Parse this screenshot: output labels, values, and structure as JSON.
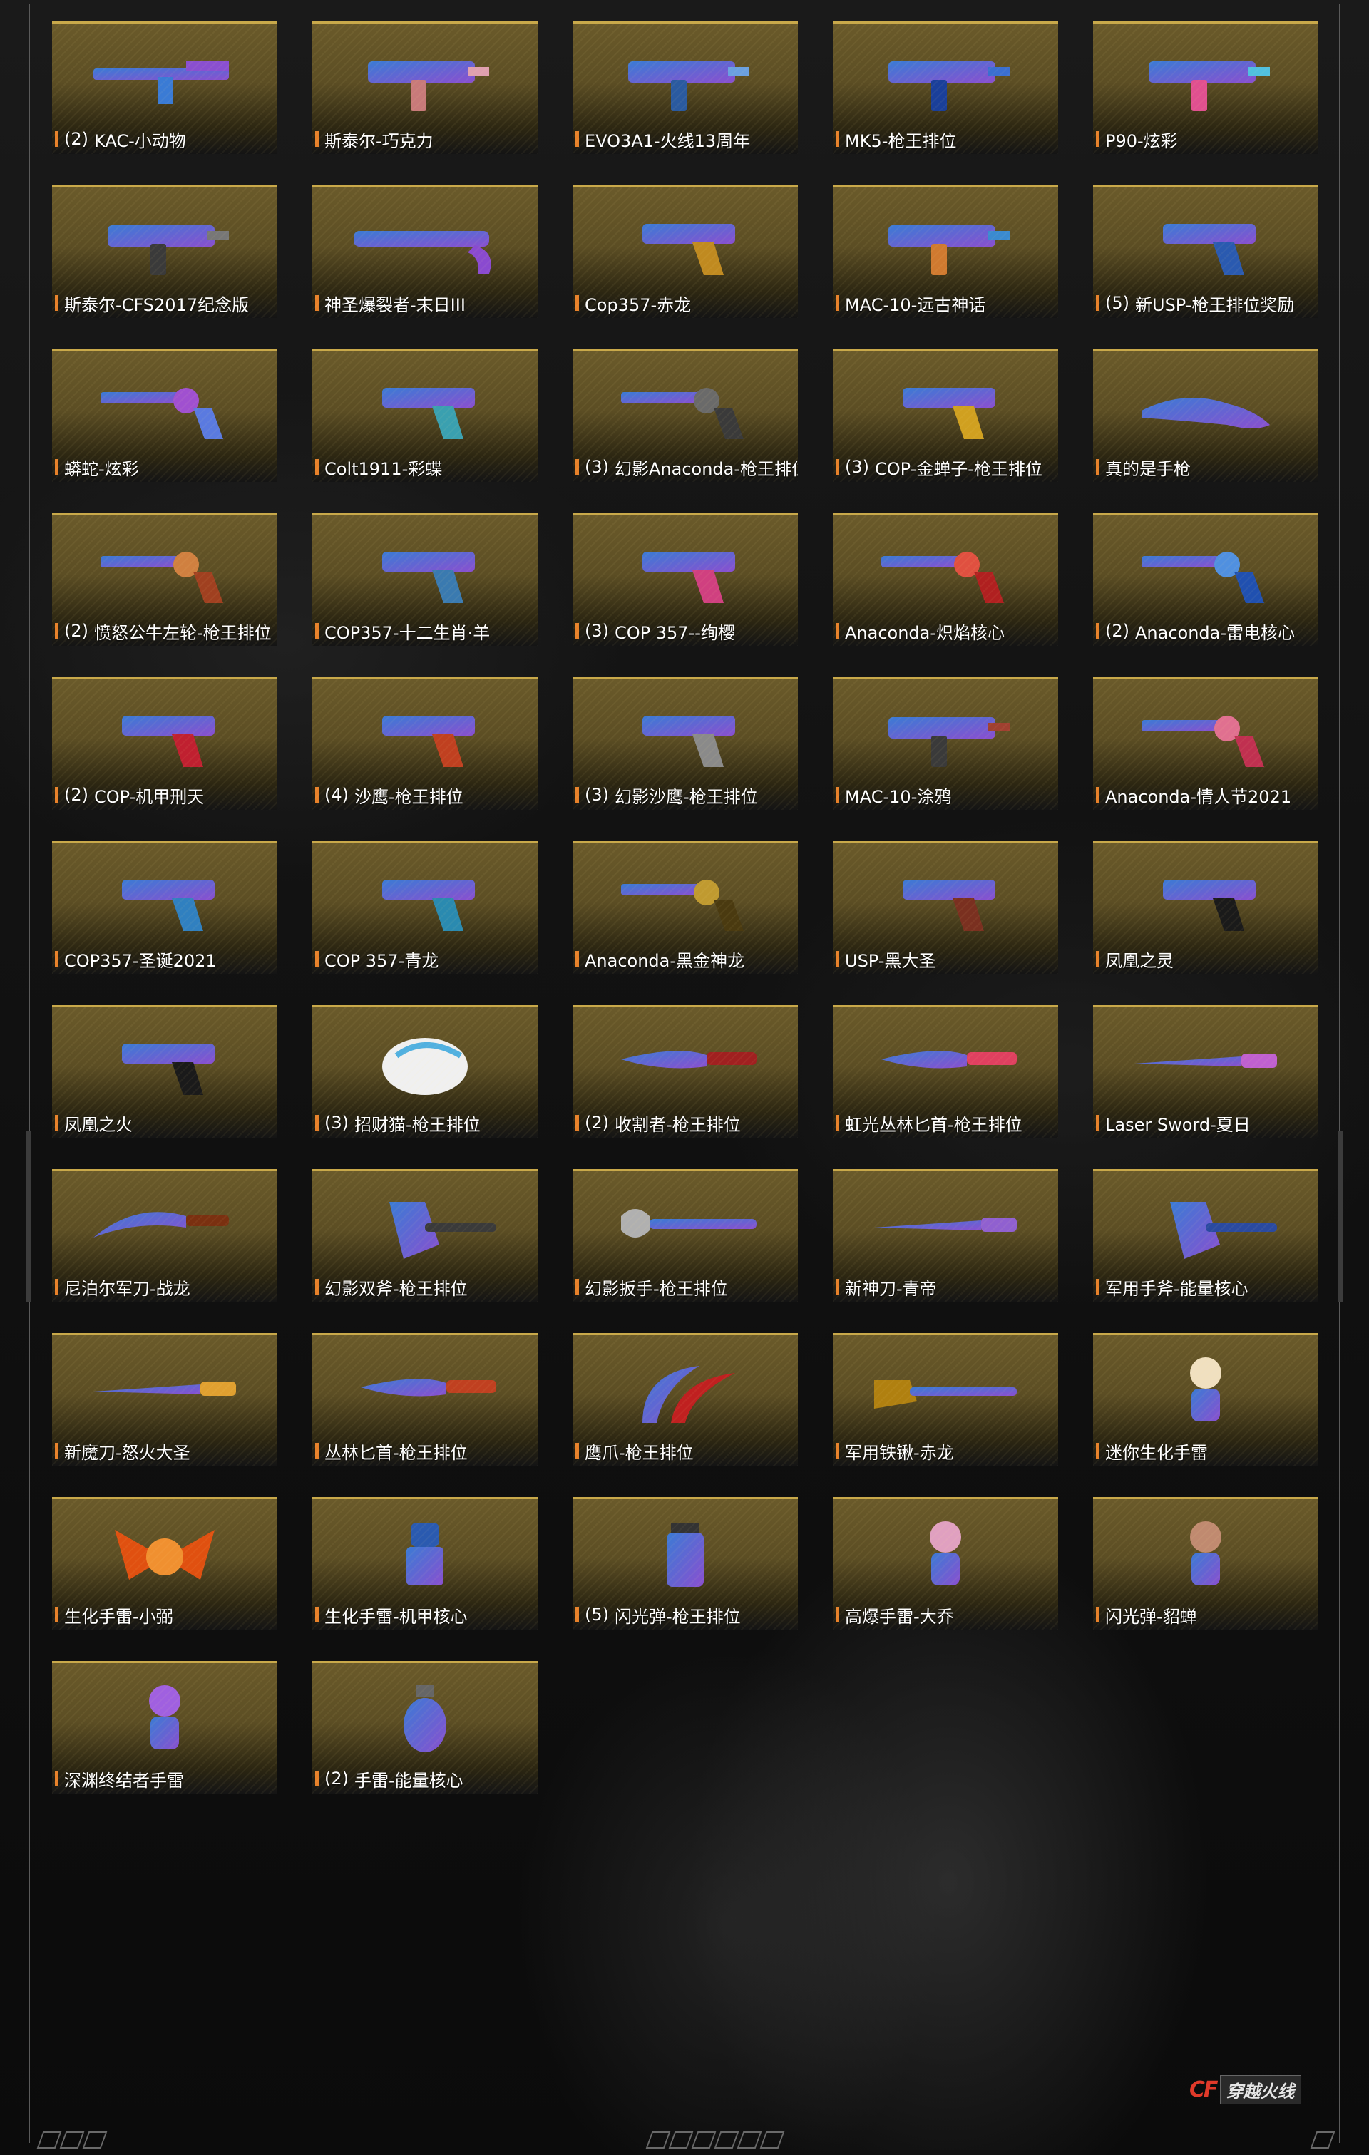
{
  "items": [
    {
      "num": "(2)",
      "label": "KAC-小动物",
      "icon": "rifle-icon",
      "colors": [
        "#3a7bd5",
        "#8a4fd0"
      ]
    },
    {
      "num": "",
      "label": "斯泰尔-巧克力",
      "icon": "smg-icon",
      "colors": [
        "#c87a7a",
        "#e0a0b0"
      ]
    },
    {
      "num": "",
      "label": "EVO3A1-火线13周年",
      "icon": "smg-icon",
      "colors": [
        "#2a5aa0",
        "#6aa0e0"
      ]
    },
    {
      "num": "",
      "label": "MK5-枪王排位",
      "icon": "smg-icon",
      "colors": [
        "#1a3f9a",
        "#3a6fd0"
      ]
    },
    {
      "num": "",
      "label": "P90-炫彩",
      "icon": "smg-icon",
      "colors": [
        "#e05090",
        "#50c0e0"
      ]
    },
    {
      "num": "",
      "label": "斯泰尔-CFS2017纪念版",
      "icon": "smg-icon",
      "colors": [
        "#3a3a3a",
        "#777777"
      ]
    },
    {
      "num": "",
      "label": "神圣爆裂者-末日III",
      "icon": "shotgun-icon",
      "colors": [
        "#8a4ad0",
        "#c090f0"
      ]
    },
    {
      "num": "",
      "label": "Cop357-赤龙",
      "icon": "pistol-icon",
      "colors": [
        "#c08a20",
        "#e0c050"
      ]
    },
    {
      "num": "",
      "label": "MAC-10-远古神话",
      "icon": "smg-icon",
      "colors": [
        "#d07a30",
        "#3a8ad0"
      ]
    },
    {
      "num": "(5)",
      "label": "新USP-枪王排位奖励",
      "icon": "pistol-icon",
      "colors": [
        "#2a5ab0",
        "#5a8ae0"
      ]
    },
    {
      "num": "",
      "label": "蟒蛇-炫彩",
      "icon": "revolver-icon",
      "colors": [
        "#5a7ae0",
        "#a050d0"
      ]
    },
    {
      "num": "",
      "label": "Colt1911-彩蝶",
      "icon": "pistol-icon",
      "colors": [
        "#3aa0b0",
        "#80d0e0"
      ]
    },
    {
      "num": "(3)",
      "label": "幻影Anaconda-枪王排位",
      "icon": "revolver-icon",
      "colors": [
        "#3a3a3a",
        "#6a6a6a"
      ]
    },
    {
      "num": "(3)",
      "label": "COP-金蝉子-枪王排位",
      "icon": "pistol-icon",
      "colors": [
        "#d0a020",
        "#f0d060"
      ]
    },
    {
      "num": "",
      "label": "真的是手枪",
      "icon": "hand-icon",
      "colors": [
        "#e0b090",
        "#c08a70"
      ]
    },
    {
      "num": "(2)",
      "label": "愤怒公牛左轮-枪王排位",
      "icon": "revolver-icon",
      "colors": [
        "#a04020",
        "#d08040"
      ]
    },
    {
      "num": "",
      "label": "COP357-十二生肖·羊",
      "icon": "pistol-icon",
      "colors": [
        "#3a7ab0",
        "#80c0e0"
      ]
    },
    {
      "num": "(3)",
      "label": "COP 357--绚樱",
      "icon": "pistol-icon",
      "colors": [
        "#d04080",
        "#f0a0c0"
      ]
    },
    {
      "num": "",
      "label": "Anaconda-炽焰核心",
      "icon": "revolver-icon",
      "colors": [
        "#b02020",
        "#e05040"
      ]
    },
    {
      "num": "(2)",
      "label": "Anaconda-雷电核心",
      "icon": "revolver-icon",
      "colors": [
        "#2050b0",
        "#5090e0"
      ]
    },
    {
      "num": "(2)",
      "label": "COP-机甲刑天",
      "icon": "pistol-icon",
      "colors": [
        "#c02030",
        "#3050b0"
      ]
    },
    {
      "num": "(4)",
      "label": "沙鹰-枪王排位",
      "icon": "pistol-icon",
      "colors": [
        "#c04020",
        "#e0a040"
      ]
    },
    {
      "num": "(3)",
      "label": "幻影沙鹰-枪王排位",
      "icon": "pistol-icon",
      "colors": [
        "#8a8a8a",
        "#c0c0c0"
      ]
    },
    {
      "num": "",
      "label": "MAC-10-涂鸦",
      "icon": "smg-icon",
      "colors": [
        "#3a3a3a",
        "#a04030"
      ]
    },
    {
      "num": "",
      "label": "Anaconda-情人节2021",
      "icon": "revolver-icon",
      "colors": [
        "#c03050",
        "#e07090"
      ]
    },
    {
      "num": "",
      "label": "COP357-圣诞2021",
      "icon": "pistol-icon",
      "colors": [
        "#3080c0",
        "#e0c040"
      ]
    },
    {
      "num": "",
      "label": "COP 357-青龙",
      "icon": "pistol-icon",
      "colors": [
        "#2a8ab0",
        "#e0c040"
      ]
    },
    {
      "num": "",
      "label": "Anaconda-黑金神龙",
      "icon": "revolver-icon",
      "colors": [
        "#4a3a10",
        "#c09a30"
      ]
    },
    {
      "num": "",
      "label": "USP-黑大圣",
      "icon": "pistol-icon",
      "colors": [
        "#7a3020",
        "#c06040"
      ]
    },
    {
      "num": "",
      "label": "凤凰之灵",
      "icon": "pistol-icon",
      "colors": [
        "#1a1a1a",
        "#e0b030"
      ]
    },
    {
      "num": "",
      "label": "凤凰之火",
      "icon": "pistol-icon",
      "colors": [
        "#1a1a1a",
        "#d09a30"
      ]
    },
    {
      "num": "(3)",
      "label": "招财猫-枪王排位",
      "icon": "paw-icon",
      "colors": [
        "#f0f0f0",
        "#50b0e0"
      ]
    },
    {
      "num": "(2)",
      "label": "收割者-枪王排位",
      "icon": "knife-icon",
      "colors": [
        "#a02020",
        "#d04040"
      ]
    },
    {
      "num": "",
      "label": "虹光丛林匕首-枪王排位",
      "icon": "knife-icon",
      "colors": [
        "#e04060",
        "#60c0e0"
      ]
    },
    {
      "num": "",
      "label": "Laser Sword-夏日",
      "icon": "sword-icon",
      "colors": [
        "#e0a040",
        "#c060d0"
      ]
    },
    {
      "num": "",
      "label": "尼泊尔军刀-战龙",
      "icon": "kukri-icon",
      "colors": [
        "#7a3010",
        "#c08040"
      ]
    },
    {
      "num": "",
      "label": "幻影双斧-枪王排位",
      "icon": "axe-icon",
      "colors": [
        "#3a3a3a",
        "#8a8a8a"
      ]
    },
    {
      "num": "",
      "label": "幻影扳手-枪王排位",
      "icon": "wrench-icon",
      "colors": [
        "#6a6a6a",
        "#b0b0b0"
      ]
    },
    {
      "num": "",
      "label": "新神刀-青帝",
      "icon": "sword-icon",
      "colors": [
        "#4a2a8a",
        "#9060d0"
      ]
    },
    {
      "num": "",
      "label": "军用手斧-能量核心",
      "icon": "axe-icon",
      "colors": [
        "#2a4aa0",
        "#c03040"
      ]
    },
    {
      "num": "",
      "label": "新魔刀-怒火大圣",
      "icon": "sword-icon",
      "colors": [
        "#c04010",
        "#e0a030"
      ]
    },
    {
      "num": "",
      "label": "丛林匕首-枪王排位",
      "icon": "knife-icon",
      "colors": [
        "#c04020",
        "#e07030"
      ]
    },
    {
      "num": "",
      "label": "鹰爪-枪王排位",
      "icon": "claw-icon",
      "colors": [
        "#c02020",
        "#e06040"
      ]
    },
    {
      "num": "",
      "label": "军用铁锹-赤龙",
      "icon": "shovel-icon",
      "colors": [
        "#b08010",
        "#e0c040"
      ]
    },
    {
      "num": "",
      "label": "迷你生化手雷",
      "icon": "figure-icon",
      "colors": [
        "#3ab0c0",
        "#f0e0c0"
      ]
    },
    {
      "num": "",
      "label": "生化手雷-小弼",
      "icon": "winged-creature-icon",
      "colors": [
        "#e05010",
        "#f09030"
      ]
    },
    {
      "num": "",
      "label": "生化手雷-机甲核心",
      "icon": "robot-icon",
      "colors": [
        "#2a5ab0",
        "#c03030"
      ]
    },
    {
      "num": "(5)",
      "label": "闪光弹-枪王排位",
      "icon": "canister-icon",
      "colors": [
        "#a02010",
        "#e06020"
      ]
    },
    {
      "num": "",
      "label": "高爆手雷-大乔",
      "icon": "figure-icon",
      "colors": [
        "#5a2a7a",
        "#e0a0c0"
      ]
    },
    {
      "num": "",
      "label": "闪光弹-貂蝉",
      "icon": "figure-icon",
      "colors": [
        "#e0d0b0",
        "#c08a70"
      ]
    },
    {
      "num": "",
      "label": "深渊终结者手雷",
      "icon": "figure-icon",
      "colors": [
        "#5a2a9a",
        "#a060e0"
      ]
    },
    {
      "num": "(2)",
      "label": "手雷-能量核心",
      "icon": "grenade-icon",
      "colors": [
        "#2a4aa0",
        "#d0d0e0"
      ]
    }
  ],
  "logo": {
    "mark": "CF",
    "text": "穿越火线"
  }
}
